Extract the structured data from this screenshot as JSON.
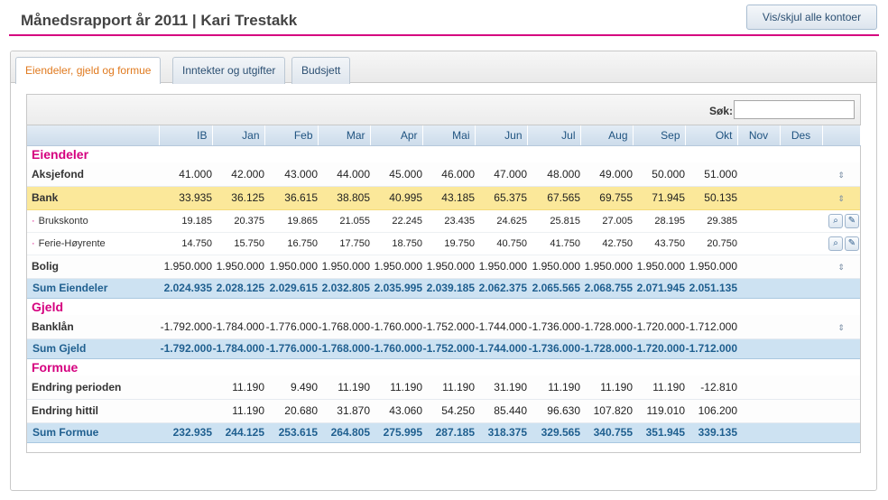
{
  "header": {
    "title": "Månedsrapport år 2011 | Kari Trestakk",
    "toggle_button": "Vis/skjul alle kontoer"
  },
  "tabs": [
    {
      "label": "Eiendeler, gjeld og formue",
      "active": true
    },
    {
      "label": "Inntekter og utgifter",
      "active": false
    },
    {
      "label": "Budsjett",
      "active": false
    }
  ],
  "search": {
    "label": "Søk:",
    "value": "",
    "placeholder": ""
  },
  "columns": [
    "",
    "IB",
    "Jan",
    "Feb",
    "Mar",
    "Apr",
    "Mai",
    "Jun",
    "Jul",
    "Aug",
    "Sep",
    "Okt",
    "Nov",
    "Des",
    ""
  ],
  "sections": {
    "eiendeler": "Eiendeler",
    "gjeld": "Gjeld",
    "formue": "Formue"
  },
  "rows": {
    "aksjefond": {
      "label": "Aksjefond",
      "values": [
        "41.000",
        "42.000",
        "43.000",
        "44.000",
        "45.000",
        "46.000",
        "47.000",
        "48.000",
        "49.000",
        "50.000",
        "51.000",
        "",
        ""
      ],
      "expand_icon": "up-down-arrows-icon"
    },
    "bank": {
      "label": "Bank",
      "values": [
        "33.935",
        "36.125",
        "36.615",
        "38.805",
        "40.995",
        "43.185",
        "65.375",
        "67.565",
        "69.755",
        "71.945",
        "50.135",
        "",
        ""
      ],
      "expand_icon": "up-down-arrows-icon"
    },
    "brukskonto": {
      "label": "Brukskonto",
      "values": [
        "19.185",
        "20.375",
        "19.865",
        "21.055",
        "22.245",
        "23.435",
        "24.625",
        "25.815",
        "27.005",
        "28.195",
        "29.385",
        "",
        ""
      ],
      "actions": [
        "search-icon",
        "edit-pencil-icon"
      ]
    },
    "ferie": {
      "label": "Ferie-Høyrente",
      "values": [
        "14.750",
        "15.750",
        "16.750",
        "17.750",
        "18.750",
        "19.750",
        "40.750",
        "41.750",
        "42.750",
        "43.750",
        "20.750",
        "",
        ""
      ],
      "actions": [
        "search-icon",
        "edit-pencil-icon"
      ]
    },
    "bolig": {
      "label": "Bolig",
      "values": [
        "1.950.000",
        "1.950.000",
        "1.950.000",
        "1.950.000",
        "1.950.000",
        "1.950.000",
        "1.950.000",
        "1.950.000",
        "1.950.000",
        "1.950.000",
        "1.950.000",
        "",
        ""
      ],
      "expand_icon": "up-down-arrows-icon"
    },
    "sum_eiendeler": {
      "label": "Sum Eiendeler",
      "values": [
        "2.024.935",
        "2.028.125",
        "2.029.615",
        "2.032.805",
        "2.035.995",
        "2.039.185",
        "2.062.375",
        "2.065.565",
        "2.068.755",
        "2.071.945",
        "2.051.135",
        "",
        ""
      ]
    },
    "banklan": {
      "label": "Banklån",
      "values": [
        "-1.792.000",
        "-1.784.000",
        "-1.776.000",
        "-1.768.000",
        "-1.760.000",
        "-1.752.000",
        "-1.744.000",
        "-1.736.000",
        "-1.728.000",
        "-1.720.000",
        "-1.712.000",
        "",
        ""
      ],
      "expand_icon": "up-down-arrows-icon"
    },
    "sum_gjeld": {
      "label": "Sum Gjeld",
      "values": [
        "-1.792.000",
        "-1.784.000",
        "-1.776.000",
        "-1.768.000",
        "-1.760.000",
        "-1.752.000",
        "-1.744.000",
        "-1.736.000",
        "-1.728.000",
        "-1.720.000",
        "-1.712.000",
        "",
        ""
      ]
    },
    "endring_perioden": {
      "label": "Endring perioden",
      "values": [
        "",
        "11.190",
        "9.490",
        "11.190",
        "11.190",
        "11.190",
        "31.190",
        "11.190",
        "11.190",
        "11.190",
        "-12.810",
        "",
        ""
      ]
    },
    "endring_hittil": {
      "label": "Endring hittil",
      "values": [
        "",
        "11.190",
        "20.680",
        "31.870",
        "43.060",
        "54.250",
        "85.440",
        "96.630",
        "107.820",
        "119.010",
        "106.200",
        "",
        ""
      ]
    },
    "sum_formue": {
      "label": "Sum Formue",
      "values": [
        "232.935",
        "244.125",
        "253.615",
        "264.805",
        "275.995",
        "287.185",
        "318.375",
        "329.565",
        "340.755",
        "351.945",
        "339.135",
        "",
        ""
      ]
    }
  },
  "colors": {
    "accent_magenta": "#d5007f",
    "highlight_row": "#fbe89a",
    "sum_row": "#cde2f2",
    "active_tab_text": "#e07a1f"
  }
}
